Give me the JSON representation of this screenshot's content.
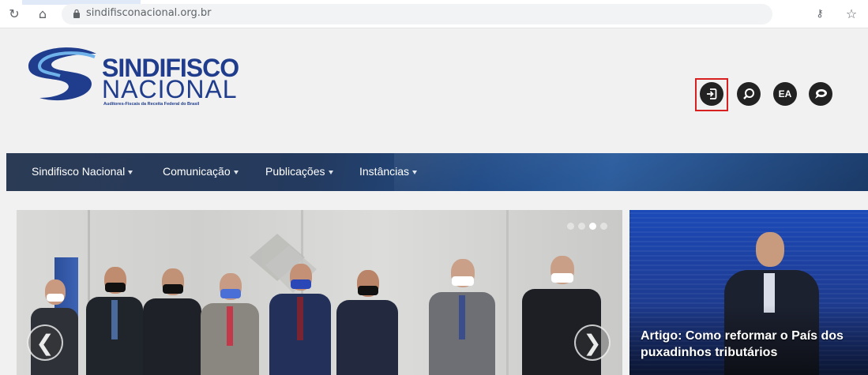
{
  "browser": {
    "url": "sindifisconacional.org.br",
    "reload_icon": "reload-icon",
    "home_icon": "home-icon",
    "key_icon": "key-icon",
    "star_icon": "star-icon"
  },
  "logo": {
    "word1": "SINDIFISCO",
    "word2": "NACIONAL",
    "tagline": "Auditores-Fiscais da Receita Federal do Brasil",
    "colors": {
      "primary": "#1f3d8c",
      "accent": "#5aa0e0"
    }
  },
  "header_icons": {
    "login_icon": "login-icon",
    "search_icon": "search-icon",
    "ea_label": "EA",
    "chat_icon": "chat-icon",
    "highlight_color": "#d92020"
  },
  "nav": {
    "items": [
      {
        "label": "Sindifisco Nacional"
      },
      {
        "label": "Comunicação"
      },
      {
        "label": "Publicações"
      },
      {
        "label": "Instâncias"
      }
    ]
  },
  "slider": {
    "prev_glyph": "❮",
    "next_glyph": "❯",
    "active_dot": 3,
    "dot_count": 4
  },
  "side_card": {
    "caption": "Artigo: Como reformar o País dos puxadinhos tributários"
  }
}
